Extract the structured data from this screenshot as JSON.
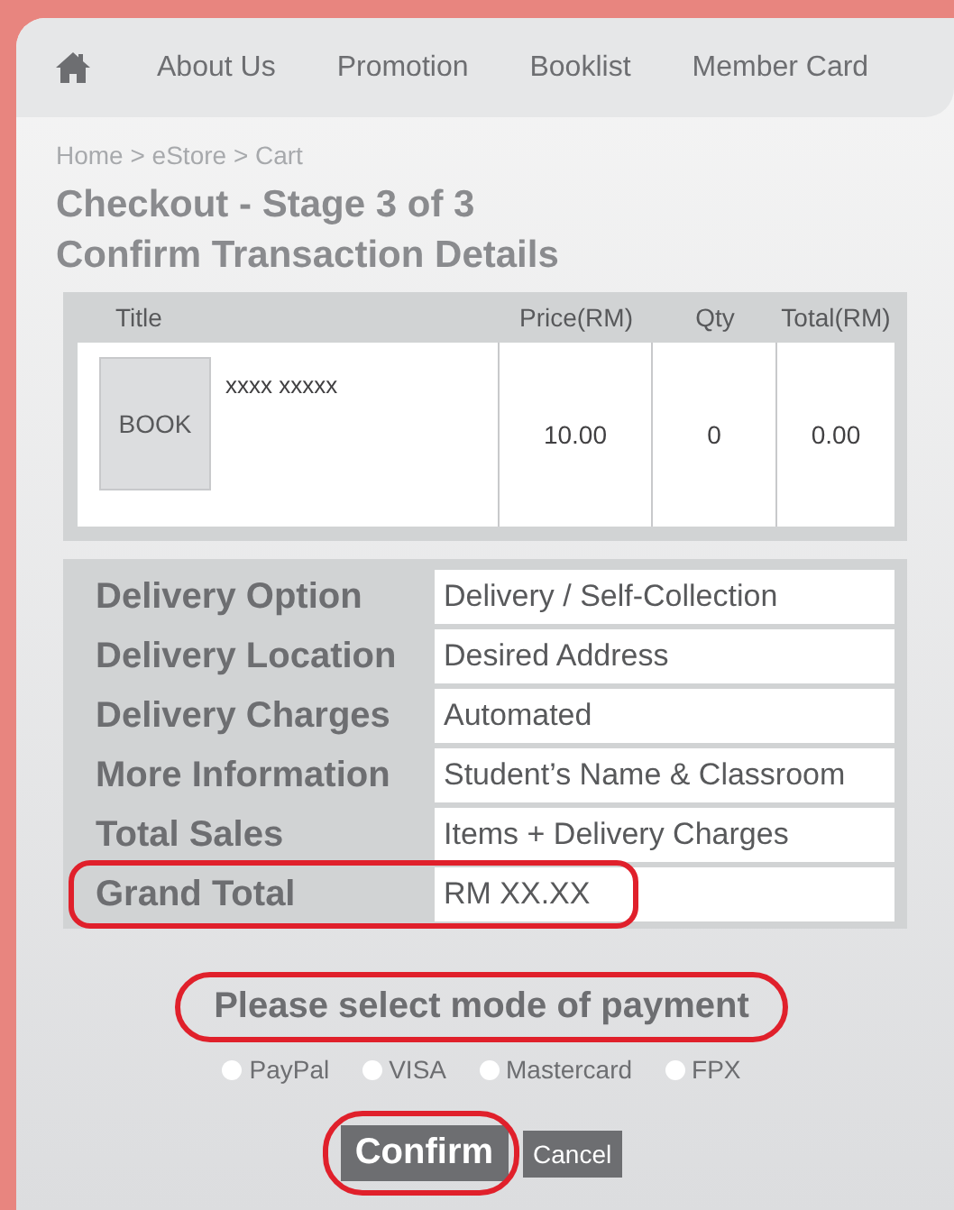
{
  "nav": {
    "items": [
      {
        "kind": "home"
      },
      {
        "kind": "link",
        "label": "About Us"
      },
      {
        "kind": "link",
        "label": "Promotion"
      },
      {
        "kind": "link",
        "label": "Booklist"
      },
      {
        "kind": "link",
        "label": "Member Card"
      }
    ]
  },
  "breadcrumb": "Home > eStore > Cart",
  "heading": [
    "Checkout - Stage 3 of 3",
    "Confirm Transaction Details"
  ],
  "cart": {
    "columns": [
      "Title",
      "Price(RM)",
      "Qty",
      "Total(RM)"
    ],
    "rows": [
      {
        "cover": "BOOK",
        "title": "xxxx xxxxx",
        "price": "10.00",
        "qty": "0",
        "total": "0.00"
      }
    ]
  },
  "details": [
    {
      "label": "Delivery Option",
      "value": "Delivery / Self-Collection",
      "highlighted": false
    },
    {
      "label": "Delivery Location",
      "value": "Desired Address",
      "highlighted": false
    },
    {
      "label": "Delivery Charges",
      "value": "Automated",
      "highlighted": false
    },
    {
      "label": "More Information",
      "value": "Student’s Name & Classroom",
      "highlighted": false
    },
    {
      "label": "Total Sales",
      "value": "Items + Delivery Charges",
      "highlighted": false
    },
    {
      "label": "Grand Total",
      "value": "RM XX.XX",
      "highlighted": true
    }
  ],
  "payment": {
    "prompt": "Please select mode of payment",
    "highlighted": true,
    "options": [
      {
        "label": "PayPal",
        "selected": false
      },
      {
        "label": "VISA",
        "selected": false
      },
      {
        "label": "Mastercard",
        "selected": false
      },
      {
        "label": "FPX",
        "selected": false
      }
    ]
  },
  "buttons": [
    {
      "kind": "primary",
      "label": "Confirm",
      "highlighted": true
    },
    {
      "kind": "secondary",
      "label": "Cancel",
      "highlighted": false
    }
  ]
}
